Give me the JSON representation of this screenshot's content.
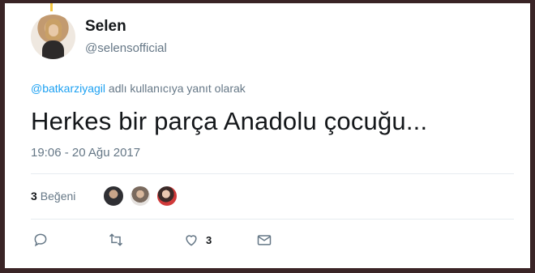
{
  "user": {
    "name": "Selen",
    "handle": "@selensofficial"
  },
  "reply_context": {
    "mention": "@batkarziyagil",
    "suffix": " adlı kullanıcıya yanıt olarak"
  },
  "tweet": {
    "text": "Herkes bir parça Anadolu çocuğu...",
    "timestamp": "19:06 - 20 Ağu 2017"
  },
  "likes": {
    "count": "3",
    "label": "Beğeni"
  },
  "actions": {
    "like_count": "3"
  },
  "colors": {
    "link": "#1da1f2",
    "secondary_text": "#657786",
    "border": "#3a2426"
  }
}
